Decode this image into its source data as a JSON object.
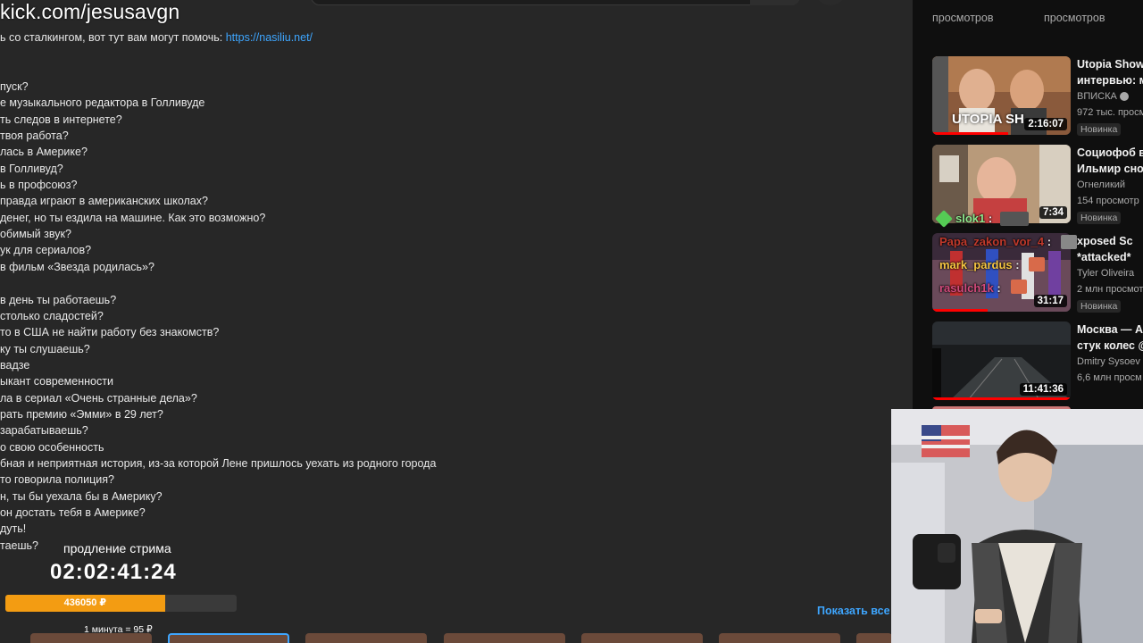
{
  "overlay": {
    "channel_url": "kick.com/jesusavgn"
  },
  "description": {
    "link_line_prefix": "ь со сталкингом, вот тут вам могут помочь: ",
    "link_url": "https://nasiliu.net/",
    "lines": [
      "",
      "",
      "пуск?",
      "е музыкального редактора в Голливуде",
      "ть следов в интернете?",
      " твоя работа?",
      "лась в Америке?",
      " в Голливуд?",
      "ь в профсоюз?",
      " правда играют в американских школах?",
      " денег, но ты ездила на машине. Как это возможно?",
      "обимый звук?",
      "ук для сериалов?",
      " в фильм «Звезда родилась»?",
      "",
      " в день ты работаешь?",
      "столько сладостей?",
      "то в США не найти работу без знакомств?",
      "ку ты слушаешь?",
      "вадзе",
      "ыкант современности",
      "ла в сериал «Очень странные дела»?",
      "рать премию «Эмми» в 29 лет?",
      "зарабатываешь?",
      "о свою особенность",
      "бная и неприятная история, из-за которой Лене пришлось уехать из родного города",
      "то говорила полиция?",
      "н, ты бы уехала бы в Америку?",
      "он достать тебя в Америке?",
      "дуть!",
      "таешь?"
    ]
  },
  "sidebar": {
    "views_left": "просмотров",
    "views_right": "просмотров",
    "videos": [
      {
        "title": "Utopia Show",
        "title2": "интервью: м",
        "channel": "ВПИСКА",
        "views": "972 тыс. просм",
        "badge": "Новинка",
        "duration": "2:16:07",
        "thumb_text": "UTOPIA SH",
        "progress": 0.55
      },
      {
        "title": "Социофоб в",
        "title2": "Ильмир сно",
        "channel": "Огнеликий",
        "views": "154 просмотр",
        "badge": "Новинка",
        "duration": "7:34",
        "progress": 0
      },
      {
        "title": "xposed Sc",
        "title2": "*attacked*",
        "channel": "Tyler Oliveira",
        "views": "2 млн просмот",
        "badge": "Новинка",
        "duration": "31:17",
        "progress": 0.4
      },
      {
        "title": "Москва — А",
        "title2": "стук колес @",
        "channel": "Dmitry Sysoev",
        "views": "6,6 млн просм",
        "badge": "",
        "duration": "11:41:36",
        "progress": 1.0
      }
    ]
  },
  "chat": {
    "users": [
      {
        "name": "slok1",
        "suffix": " :",
        "color": "#8ee88e"
      },
      {
        "name": "Papa_zakon_vor_4",
        "suffix": " :",
        "color": "#c0392b"
      },
      {
        "name": "mark_pardus",
        "suffix": " :",
        "color": "#f5c542"
      },
      {
        "name": "rasulch1k",
        "suffix": " :",
        "color": "#d24a7c"
      }
    ]
  },
  "subathon": {
    "label": "продление стрима",
    "timer": "02:02:41:24",
    "amount": "436050 ₽",
    "progress_fraction": 0.69,
    "rate": "1 минута = 95 ₽"
  },
  "show_all": "Показать все",
  "colors": {
    "accent_link": "#3ea6ff",
    "progress": "#f39c12",
    "yt_red": "#ff0000"
  }
}
